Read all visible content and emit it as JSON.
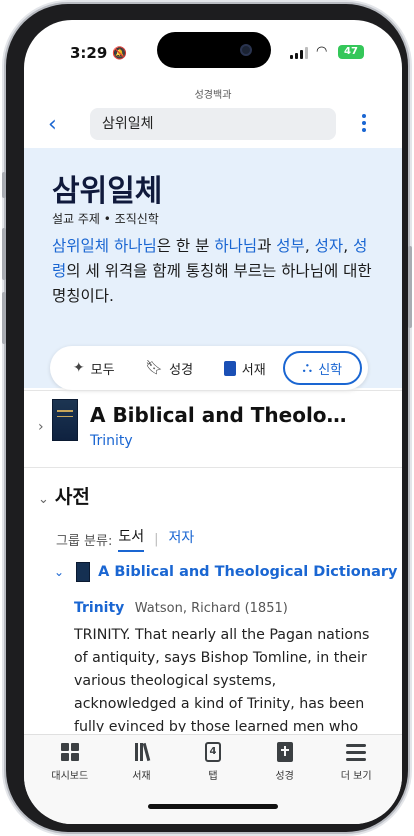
{
  "status_bar": {
    "time": "3:29",
    "battery": "47"
  },
  "app": {
    "title": "성경백과"
  },
  "search": {
    "query": "삼위일체"
  },
  "hero": {
    "title": "삼위일체",
    "subtitle": "설교 주제 • 조직신학",
    "definition": {
      "link1": "삼위일체 하나님",
      "t1": "은 한 분 ",
      "link2": "하나님",
      "t2": "과 ",
      "link3": "성부",
      "t3": ", ",
      "link4": "성자",
      "t4": ", ",
      "link5": "성령",
      "t5": "의 세 위격을 함께 통칭해 부르는 하나님에 대한 명칭이다."
    }
  },
  "filters": [
    {
      "label": "모두",
      "icon": "sparkle-icon",
      "active": false
    },
    {
      "label": "성경",
      "icon": "bookmark-icon",
      "active": false
    },
    {
      "label": "서재",
      "icon": "book-icon",
      "active": false
    },
    {
      "label": "신학",
      "icon": "network-icon",
      "active": true
    }
  ],
  "book": {
    "title": "A Biblical and Theolo…",
    "subtitle": "Trinity"
  },
  "dictionary": {
    "heading": "사전",
    "group_label": "그룹 분류:",
    "group_tabs": [
      "도서",
      "저자"
    ],
    "entry": {
      "title": "A Biblical and Theological Dictionary",
      "term": "Trinity",
      "author": "Watson, Richard (1851)",
      "text": "TRINITY. That nearly all the Pagan nations of antiquity, says Bishop Tomline, in their various theological systems, acknowledged a kind of Trinity, has been fully evinced by those learned men who have…"
    }
  },
  "tabbar": [
    {
      "label": "대시보드",
      "icon": "dashboard-icon"
    },
    {
      "label": "서재",
      "icon": "library-icon"
    },
    {
      "label": "탭",
      "icon": "tabs-icon",
      "badge": "4"
    },
    {
      "label": "성경",
      "icon": "bible-icon"
    },
    {
      "label": "더 보기",
      "icon": "menu-icon"
    }
  ],
  "colors": {
    "accent": "#1a66d2",
    "hero_bg": "#e6f0fb",
    "battery": "#34c759"
  }
}
